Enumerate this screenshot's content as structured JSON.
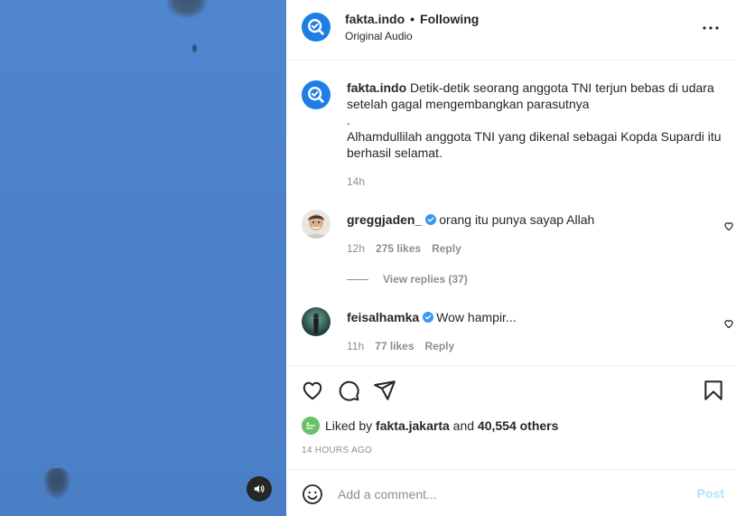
{
  "post": {
    "username": "fakta.indo",
    "separator": "•",
    "follow_status": "Following",
    "audio": "Original Audio",
    "more_label": "•••"
  },
  "caption": {
    "username": "fakta.indo",
    "line1": " Detik-detik seorang anggota TNI terjun bebas di udara setelah gagal mengembangkan parasutnya",
    "line2": ".",
    "line3": "Alhamdullilah anggota TNI yang dikenal sebagai Kopda Supardi itu berhasil selamat.",
    "time": "14h"
  },
  "comments": [
    {
      "username": "greggjaden_",
      "text": "orang itu punya sayap Allah",
      "time": "12h",
      "likes": "275 likes",
      "reply": "Reply"
    },
    {
      "username": "feisalhamka",
      "text": "Wow hampir...",
      "time": "11h",
      "likes": "77 likes",
      "reply": "Reply"
    }
  ],
  "view_replies": "View replies (37)",
  "likes": {
    "prefix": "Liked by ",
    "user": "fakta.jakarta",
    "middle": " and ",
    "count": "40,554 others"
  },
  "timestamp": "14 HOURS AGO",
  "add_comment": {
    "placeholder": "Add a comment...",
    "post_label": "Post"
  },
  "colors": {
    "brand": "#1f7de6",
    "sky": "#4f86cf",
    "post_button": "#b2dffc",
    "muted": "#8e8e8e"
  }
}
